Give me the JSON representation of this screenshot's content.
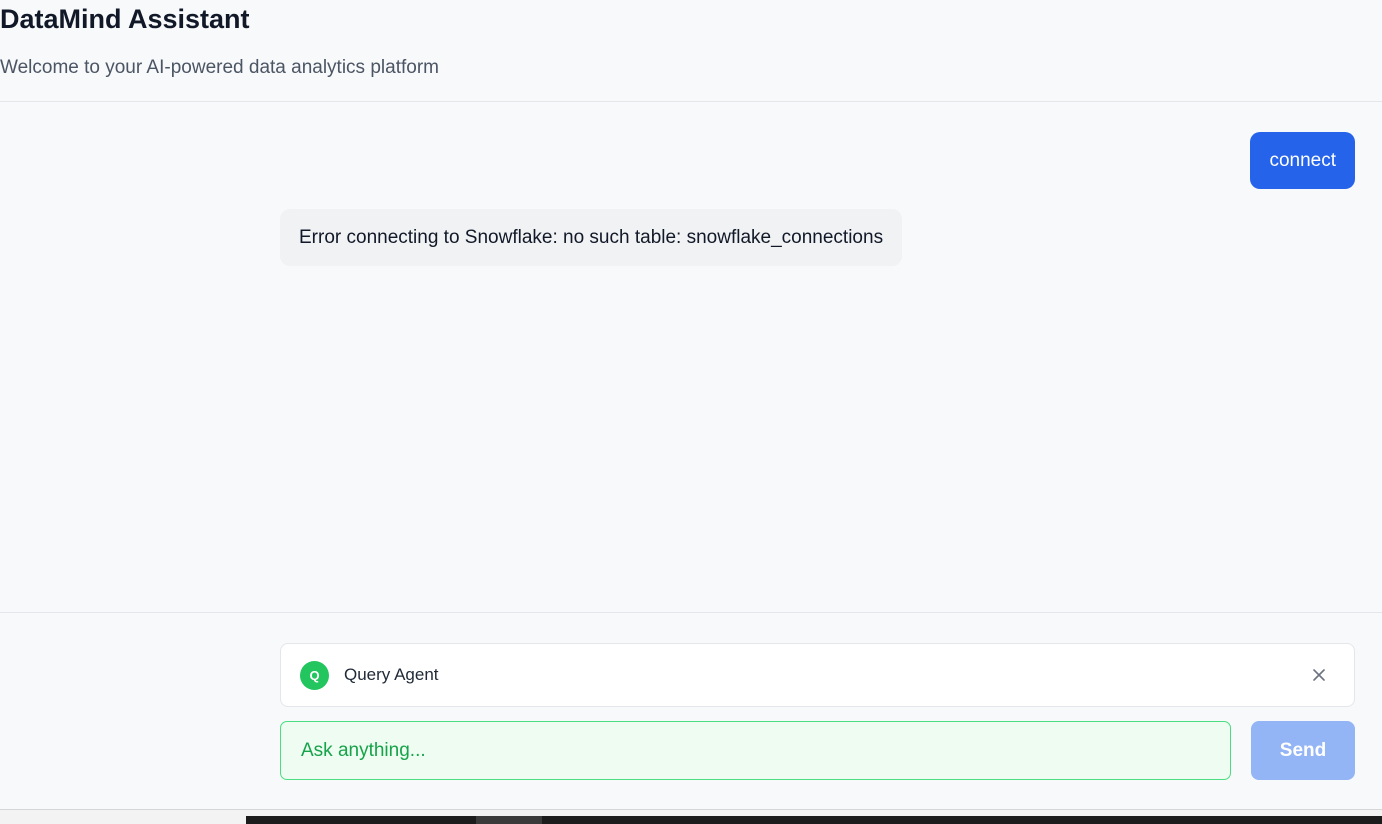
{
  "header": {
    "title": "DataMind Assistant",
    "subtitle": "Welcome to your AI-powered data analytics platform"
  },
  "chat": {
    "messages": [
      {
        "role": "user",
        "text": "connect"
      },
      {
        "role": "assistant",
        "text": "Error connecting to Snowflake: no such table: snowflake_connections"
      }
    ]
  },
  "composer": {
    "agent": {
      "badge": "Q",
      "name": "Query Agent",
      "badge_color": "#22c55e",
      "close_icon": "close-icon"
    },
    "input": {
      "placeholder": "Ask anything...",
      "value": ""
    },
    "send_label": "Send"
  },
  "colors": {
    "accent": "#2563eb",
    "send_disabled": "#93b4f5",
    "input_border": "#4ade80",
    "input_background": "#effcf1"
  }
}
